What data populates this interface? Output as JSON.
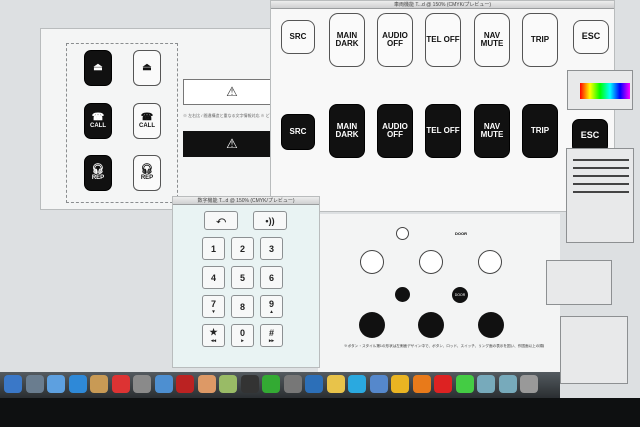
{
  "window_titles": {
    "main": "車両機能 T...d @ 150% (CMYK/プレビュー)",
    "keypad": "数字機能 T...d @ 150% (CMYK/プレビュー)"
  },
  "back_window": {
    "white_buttons": [
      {
        "icon": "eject-icon",
        "label": ""
      },
      {
        "icon": "call-icon",
        "label": "CALL"
      },
      {
        "icon": "headphone-icon",
        "label": "REP"
      }
    ],
    "black_buttons": [
      {
        "icon": "eject-icon",
        "label": ""
      },
      {
        "icon": "call-icon",
        "label": "CALL"
      },
      {
        "icon": "headphone-icon",
        "label": "REP"
      }
    ],
    "note": "※ 左右比 / 間違構造と重なる文字情報対応 ※ どうして 3"
  },
  "main_window": {
    "white_row": [
      "SRC",
      "MAIN DARK",
      "AUDIO OFF",
      "TEL OFF",
      "NAV MUTE",
      "TRIP",
      "ESC"
    ],
    "black_row": [
      "SRC",
      "MAIN DARK",
      "AUDIO OFF",
      "TEL OFF",
      "NAV MUTE",
      "TRIP",
      "ESC"
    ]
  },
  "lower_canvas": {
    "small_labels": [
      "DOOR",
      "DOOR"
    ],
    "footnote": "※ボタン・スタイル第1の形状は左側面デザイン中で、ボタン、ロッド、スイッチ、リング面の表示を図い、作図面以上の順番"
  },
  "keypad": {
    "top_keys": [
      "hook-icon",
      "volume-icon"
    ],
    "keys": [
      {
        "num": "1",
        "sub": ""
      },
      {
        "num": "2",
        "sub": ""
      },
      {
        "num": "3",
        "sub": ""
      },
      {
        "num": "4",
        "sub": ""
      },
      {
        "num": "5",
        "sub": ""
      },
      {
        "num": "6",
        "sub": ""
      },
      {
        "num": "7",
        "sub": "▾"
      },
      {
        "num": "8",
        "sub": ""
      },
      {
        "num": "9",
        "sub": "▴"
      },
      {
        "num": "★",
        "sub": "◂◂"
      },
      {
        "num": "0",
        "sub": "▸"
      },
      {
        "num": "#",
        "sub": "▸▸"
      }
    ]
  },
  "colors": {
    "background": "#dde0e2",
    "button_black": "#111111",
    "dock": "#2a2e31"
  },
  "dock": {
    "icons": [
      "finder-icon",
      "dashboard-icon",
      "mail-icon",
      "safari-icon",
      "address-book-icon",
      "ical-icon",
      "preview-icon",
      "itunes-icon",
      "photo-booth-icon",
      "garageband-icon",
      "iphoto-icon",
      "dvd-icon",
      "time-machine-icon",
      "system-preferences-icon",
      "quicktime-icon",
      "pen-icon",
      "skype-icon",
      "twitter-icon",
      "yammer-icon",
      "illustrator-icon",
      "flash-icon",
      "sync-icon",
      "folder-icon",
      "folder-icon",
      "trash-icon"
    ]
  }
}
